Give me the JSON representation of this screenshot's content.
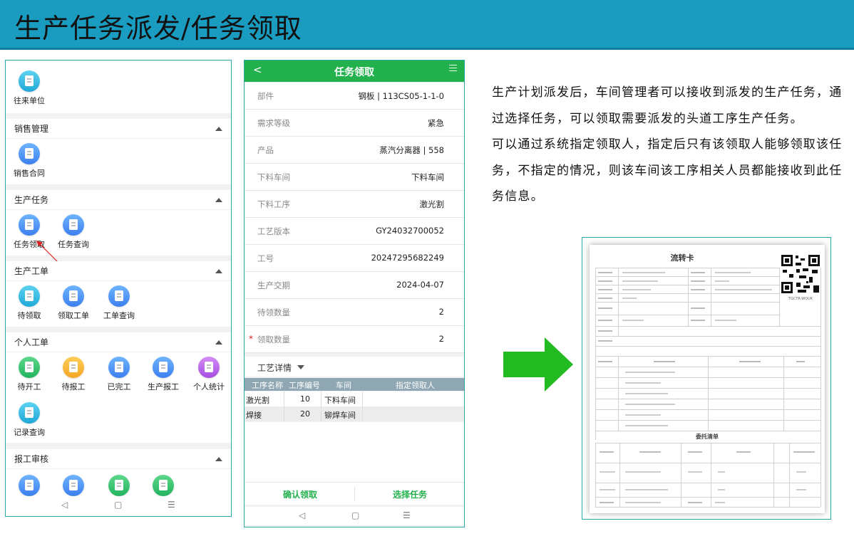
{
  "header": {
    "title": "生产任务派发/任务领取"
  },
  "phone_left": {
    "top_item": {
      "label": "往来单位",
      "icon": "contacts-icon"
    },
    "sections": [
      {
        "title": "销售管理",
        "items": [
          {
            "label": "销售合同",
            "icon": "cart-icon",
            "color": "blue"
          }
        ]
      },
      {
        "title": "生产任务",
        "items": [
          {
            "label": "任务领取",
            "icon": "clipboard-icon",
            "color": "blue"
          },
          {
            "label": "任务查询",
            "icon": "task-search-icon",
            "color": "blue"
          }
        ]
      },
      {
        "title": "生产工单",
        "items": [
          {
            "label": "待领取",
            "icon": "doc-pending-icon",
            "color": "teal"
          },
          {
            "label": "领取工单",
            "icon": "clipboard-icon",
            "color": "blue"
          },
          {
            "label": "工单查询",
            "icon": "task-search-icon",
            "color": "blue"
          }
        ]
      },
      {
        "title": "个人工单",
        "items": [
          {
            "label": "待开工",
            "icon": "doc-start-icon",
            "color": "green"
          },
          {
            "label": "待报工",
            "icon": "doc-report-icon",
            "color": "orange"
          },
          {
            "label": "已完工",
            "icon": "task-done-icon",
            "color": "blue"
          },
          {
            "label": "生产报工",
            "icon": "clipboard-icon",
            "color": "blue"
          },
          {
            "label": "个人统计",
            "icon": "doc-stats-icon",
            "color": "purple"
          },
          {
            "label": "记录查询",
            "icon": "doc-record-icon",
            "color": "teal"
          }
        ]
      },
      {
        "title": "报工审核",
        "items": [
          {
            "label": "",
            "icon": "font-icon",
            "color": "blue"
          },
          {
            "label": "",
            "icon": "doc-review-icon",
            "color": "blue"
          },
          {
            "label": "",
            "icon": "image-doc-icon",
            "color": "green"
          },
          {
            "label": "",
            "icon": "list-icon",
            "color": "green"
          }
        ]
      }
    ],
    "nav": {
      "back": "◁",
      "home": "▢",
      "menu": "☰"
    }
  },
  "phone_right": {
    "title": "任务领取",
    "back": "<",
    "fields": [
      {
        "label": "部件",
        "value": "钢板 | 113CS05-1-1-0"
      },
      {
        "label": "需求等级",
        "value": "紧急"
      },
      {
        "label": "产品",
        "value": "蒸汽分离器 | 558"
      },
      {
        "label": "下料车间",
        "value": "下料车间"
      },
      {
        "label": "下料工序",
        "value": "激光割"
      },
      {
        "label": "工艺版本",
        "value": "GY24032700052"
      },
      {
        "label": "工号",
        "value": "20247295682249"
      },
      {
        "label": "生产交期",
        "value": "2024-04-07"
      },
      {
        "label": "待领数量",
        "value": "2"
      },
      {
        "label": "领取数量",
        "value": "2",
        "required": "*"
      }
    ],
    "detail_label": "工艺详情",
    "table": {
      "headers": [
        "工序名称",
        "工序编号",
        "车间",
        "指定领取人"
      ],
      "rows": [
        [
          "激光割",
          "10",
          "下料车间",
          ""
        ],
        [
          "焊接",
          "20",
          "铆焊车间",
          ""
        ]
      ]
    },
    "actions": {
      "confirm": "确认领取",
      "select": "选择任务"
    },
    "nav": {
      "back": "◁",
      "home": "▢",
      "menu": "☰"
    }
  },
  "description": {
    "p1": "生产计划派发后，车间管理者可以接收到派发的生产任务，通过选择任务，可以领取需要派发的头道工序生产任务。",
    "p2": "可以通过系统指定领取人，指定后只有该领取人能够领取该任务，不指定的情况，则该车间该工序相关人员都能接收到此任务信息。"
  },
  "card": {
    "title": "流转卡",
    "section2_title": "委托清单",
    "qr_caption": "TGCTR-WOUK"
  },
  "colors": {
    "banner": "#1a9cc1",
    "accent_green": "#22b14c",
    "arrow_green": "#22bb22"
  }
}
